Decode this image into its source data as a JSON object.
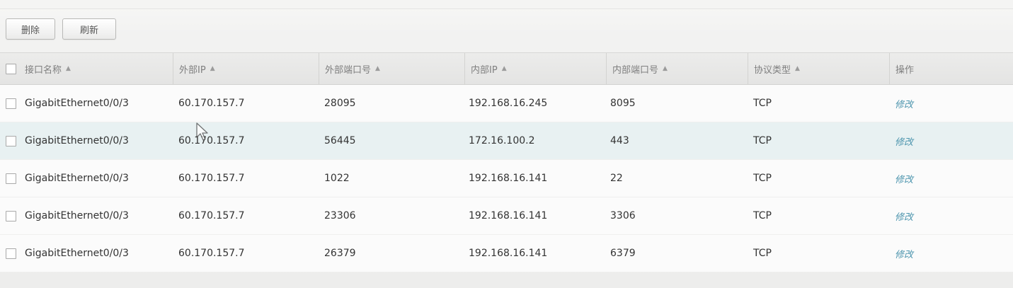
{
  "toolbar": {
    "delete_label": "删除",
    "refresh_label": "刷新"
  },
  "table": {
    "columns": [
      {
        "label": "接口名称",
        "sort": "▲"
      },
      {
        "label": "外部IP",
        "sort": "▲"
      },
      {
        "label": "外部端口号",
        "sort": "▲"
      },
      {
        "label": "内部IP",
        "sort": "▲"
      },
      {
        "label": "内部端口号",
        "sort": "▲"
      },
      {
        "label": "协议类型",
        "sort": "▲"
      },
      {
        "label": "操作"
      }
    ],
    "rows": [
      {
        "iface": "GigabitEthernet0/0/3",
        "ext_ip": "60.170.157.7",
        "ext_port": "28095",
        "int_ip": "192.168.16.245",
        "int_port": "8095",
        "protocol": "TCP",
        "action": "修改"
      },
      {
        "iface": "GigabitEthernet0/0/3",
        "ext_ip": "60.170.157.7",
        "ext_port": "56445",
        "int_ip": "172.16.100.2",
        "int_port": "443",
        "protocol": "TCP",
        "action": "修改"
      },
      {
        "iface": "GigabitEthernet0/0/3",
        "ext_ip": "60.170.157.7",
        "ext_port": "1022",
        "int_ip": "192.168.16.141",
        "int_port": "22",
        "protocol": "TCP",
        "action": "修改"
      },
      {
        "iface": "GigabitEthernet0/0/3",
        "ext_ip": "60.170.157.7",
        "ext_port": "23306",
        "int_ip": "192.168.16.141",
        "int_port": "3306",
        "protocol": "TCP",
        "action": "修改"
      },
      {
        "iface": "GigabitEthernet0/0/3",
        "ext_ip": "60.170.157.7",
        "ext_port": "26379",
        "int_ip": "192.168.16.141",
        "int_port": "6379",
        "protocol": "TCP",
        "action": "修改"
      }
    ]
  },
  "colors": {
    "link": "#4d95ae",
    "hover_row": "#e8f1f2"
  },
  "icons": {
    "sort": "sort-asc-icon",
    "cursor": "mouse-pointer-icon"
  }
}
